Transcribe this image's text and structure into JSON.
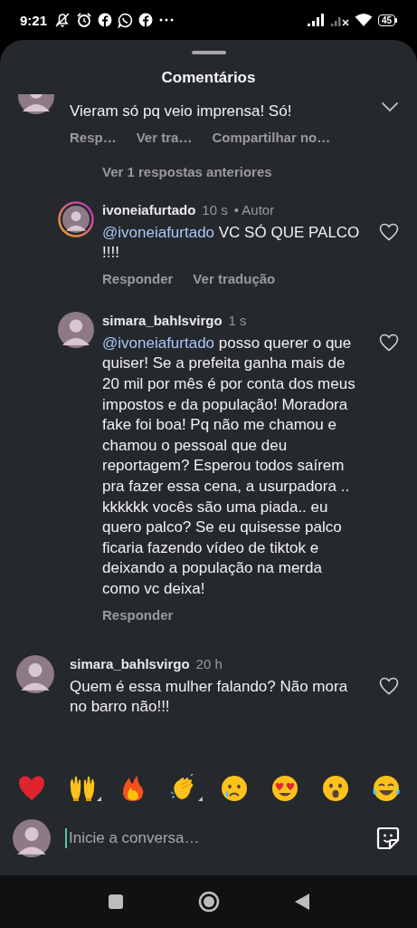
{
  "status_bar": {
    "time": "9:21",
    "battery": "45"
  },
  "sheet": {
    "title": "Comentários"
  },
  "comments": [
    {
      "kind": "top",
      "text": "Vieram só pq veio imprensa! Só!",
      "actions": [
        "Resp…",
        "Ver tra…",
        "Compartilhar no…"
      ]
    },
    {
      "kind": "more",
      "label": "Ver 1 respostas anteriores"
    },
    {
      "kind": "reply",
      "username": "ivoneiafurtado",
      "time": "10 s",
      "badge": "• Autor",
      "story_ring": true,
      "mention": "@ivoneiafurtado",
      "text": "VC SÓ QUE PALCO !!!!",
      "actions": [
        "Responder",
        "Ver tradução"
      ],
      "liked": false
    },
    {
      "kind": "reply",
      "username": "simara_bahlsvirgo",
      "time": "1 s",
      "story_ring": false,
      "mention": "@ivoneiafurtado",
      "text": "posso querer o que quiser! Se a prefeita ganha mais de 20 mil por mês é por conta dos meus impostos e da população! Moradora fake foi boa! Pq não me chamou e chamou o pessoal que deu reportagem? Esperou todos saírem pra fazer essa cena, a usurpadora .. kkkkkk vocês são uma piada.. eu quero palco? Se eu quisesse palco ficaria fazendo vídeo de tiktok e deixando a população na merda como vc deixa!",
      "actions": [
        "Responder"
      ],
      "liked": false
    },
    {
      "kind": "comment",
      "username": "simara_bahlsvirgo",
      "time": "20 h",
      "story_ring": false,
      "text": "Quem é essa mulher falando? Não mora no barro não!!!",
      "liked": false
    }
  ],
  "reactions": [
    {
      "kind": "heart",
      "has_variants": false
    },
    {
      "kind": "raised-hands",
      "has_variants": true
    },
    {
      "kind": "fire",
      "has_variants": false
    },
    {
      "kind": "clap",
      "has_variants": true
    },
    {
      "kind": "crying",
      "has_variants": false
    },
    {
      "kind": "heart-eyes",
      "has_variants": false
    },
    {
      "kind": "surprised",
      "has_variants": false
    },
    {
      "kind": "joy",
      "has_variants": false
    }
  ],
  "composer": {
    "placeholder": "Inicie a conversa…"
  }
}
